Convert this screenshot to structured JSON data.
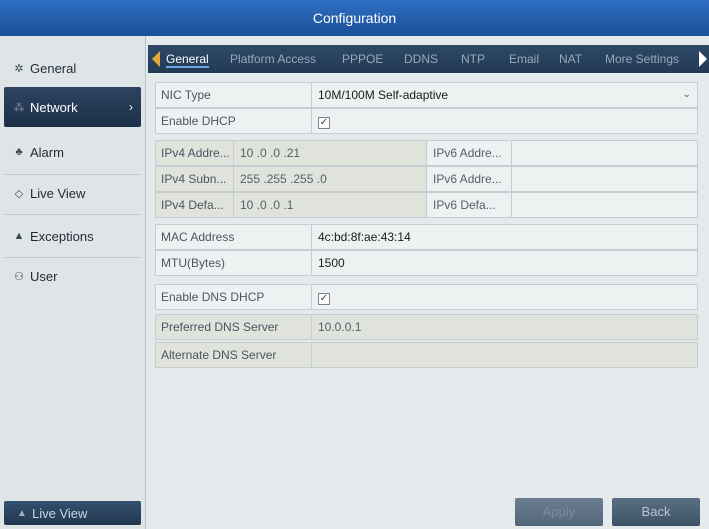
{
  "window": {
    "title": "Configuration"
  },
  "sidebar": {
    "items": [
      {
        "label": "General",
        "icon": "gear-icon"
      },
      {
        "label": "Network",
        "icon": "network-icon"
      },
      {
        "label": "Alarm",
        "icon": "alarm-icon"
      },
      {
        "label": "Live View",
        "icon": "eye-icon"
      },
      {
        "label": "Exceptions",
        "icon": "warning-icon"
      },
      {
        "label": "User",
        "icon": "users-icon"
      }
    ],
    "bottom_label": "Live View",
    "bottom_icon": "home-icon"
  },
  "tabs": [
    "General",
    "Platform Access",
    "PPPOE",
    "DDNS",
    "NTP",
    "Email",
    "NAT",
    "More Settings"
  ],
  "form": {
    "nic_type": {
      "label": "NIC Type",
      "value": "10M/100M Self-adaptive"
    },
    "enable_dhcp": {
      "label": "Enable DHCP",
      "checked": "✓"
    },
    "ipv4_address": {
      "label": "IPv4 Addre...",
      "value": "10  .0    .0    .21",
      "v6label": "IPv6 Addre..."
    },
    "ipv4_subnet": {
      "label": "IPv4 Subn...",
      "value": "255 .255 .255 .0",
      "v6label": "IPv6 Addre..."
    },
    "ipv4_default": {
      "label": "IPv4 Defa...",
      "value": "10  .0    .0    .1",
      "v6label": "IPv6 Defa..."
    },
    "mac": {
      "label": "MAC Address",
      "value": "4c:bd:8f:ae:43:14"
    },
    "mtu": {
      "label": "MTU(Bytes)",
      "value": "1500"
    },
    "enable_dns_dhcp": {
      "label": "Enable DNS DHCP",
      "checked": "✓"
    },
    "preferred_dns": {
      "label": "Preferred DNS Server",
      "value": "10.0.0.1"
    },
    "alternate_dns": {
      "label": "Alternate DNS Server",
      "value": ""
    }
  },
  "buttons": {
    "apply": "Apply",
    "back": "Back"
  }
}
